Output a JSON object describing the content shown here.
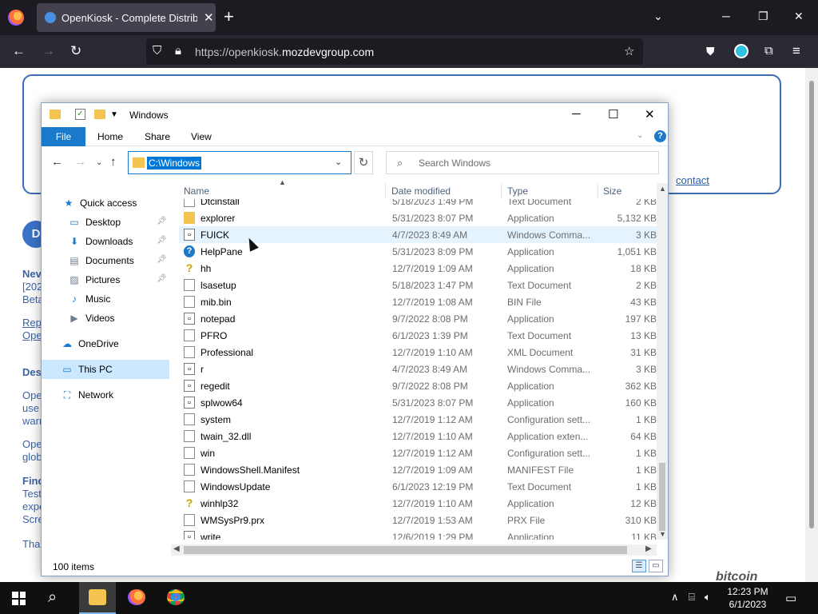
{
  "browser": {
    "tab_title": "OpenKiosk - Complete Distribu",
    "tab_close": "✕",
    "new_tab": "+",
    "url_prefix": "https://openkiosk.",
    "url_domain": "mozdevgroup.com"
  },
  "page": {
    "contact": "contact",
    "circle_letter": "D",
    "fragments": [
      "Nev",
      "[202",
      "Beta",
      "Rep",
      "Ope",
      "Des",
      "Ope",
      "use",
      "warr",
      "Ope",
      "glob",
      "Find",
      "Test",
      "expe",
      "Scre",
      "Than"
    ],
    "bitcoin": "bitcoin"
  },
  "explorer": {
    "title": "Windows",
    "ribbon": {
      "file": "File",
      "tabs": [
        "Home",
        "Share",
        "View"
      ]
    },
    "address": "C:\\Windows",
    "search_placeholder": "Search Windows",
    "status": "100 items",
    "columns": {
      "name": "Name",
      "date": "Date modified",
      "type": "Type",
      "size": "Size"
    },
    "sidebar": [
      {
        "label": "Quick access",
        "icon": "star-icon"
      },
      {
        "label": "Desktop",
        "icon": "desktop-icon",
        "pinned": true
      },
      {
        "label": "Downloads",
        "icon": "download-icon",
        "pinned": true
      },
      {
        "label": "Documents",
        "icon": "documents-icon",
        "pinned": true
      },
      {
        "label": "Pictures",
        "icon": "pictures-icon",
        "pinned": true
      },
      {
        "label": "Music",
        "icon": "music-icon"
      },
      {
        "label": "Videos",
        "icon": "videos-icon"
      },
      {
        "label": "OneDrive",
        "icon": "cloud-icon"
      },
      {
        "label": "This PC",
        "icon": "computer-icon",
        "selected": true
      },
      {
        "label": "Network",
        "icon": "network-icon"
      }
    ],
    "files": [
      {
        "name": "Dtcinstall",
        "date": "5/18/2023 1:49 PM",
        "type": "Text Document",
        "size": "2 KB",
        "icon": "doc"
      },
      {
        "name": "explorer",
        "date": "5/31/2023 8:07 PM",
        "type": "Application",
        "size": "5,132 KB",
        "icon": "folder"
      },
      {
        "name": "FUICK",
        "date": "4/7/2023 8:49 AM",
        "type": "Windows Comma...",
        "size": "3 KB",
        "icon": "app",
        "hover": true
      },
      {
        "name": "HelpPane",
        "date": "5/31/2023 8:09 PM",
        "type": "Application",
        "size": "1,051 KB",
        "icon": "help"
      },
      {
        "name": "hh",
        "date": "12/7/2019 1:09 AM",
        "type": "Application",
        "size": "18 KB",
        "icon": "hh"
      },
      {
        "name": "lsasetup",
        "date": "5/18/2023 1:47 PM",
        "type": "Text Document",
        "size": "2 KB",
        "icon": "doc"
      },
      {
        "name": "mib.bin",
        "date": "12/7/2019 1:08 AM",
        "type": "BIN File",
        "size": "43 KB",
        "icon": "doc"
      },
      {
        "name": "notepad",
        "date": "9/7/2022 8:08 PM",
        "type": "Application",
        "size": "197 KB",
        "icon": "app"
      },
      {
        "name": "PFRO",
        "date": "6/1/2023 1:39 PM",
        "type": "Text Document",
        "size": "13 KB",
        "icon": "doc"
      },
      {
        "name": "Professional",
        "date": "12/7/2019 1:10 AM",
        "type": "XML Document",
        "size": "31 KB",
        "icon": "doc"
      },
      {
        "name": "r",
        "date": "4/7/2023 8:49 AM",
        "type": "Windows Comma...",
        "size": "3 KB",
        "icon": "app"
      },
      {
        "name": "regedit",
        "date": "9/7/2022 8:08 PM",
        "type": "Application",
        "size": "362 KB",
        "icon": "app"
      },
      {
        "name": "splwow64",
        "date": "5/31/2023 8:07 PM",
        "type": "Application",
        "size": "160 KB",
        "icon": "app"
      },
      {
        "name": "system",
        "date": "12/7/2019 1:12 AM",
        "type": "Configuration sett...",
        "size": "1 KB",
        "icon": "doc"
      },
      {
        "name": "twain_32.dll",
        "date": "12/7/2019 1:10 AM",
        "type": "Application exten...",
        "size": "64 KB",
        "icon": "doc"
      },
      {
        "name": "win",
        "date": "12/7/2019 1:12 AM",
        "type": "Configuration sett...",
        "size": "1 KB",
        "icon": "doc"
      },
      {
        "name": "WindowsShell.Manifest",
        "date": "12/7/2019 1:09 AM",
        "type": "MANIFEST File",
        "size": "1 KB",
        "icon": "doc"
      },
      {
        "name": "WindowsUpdate",
        "date": "6/1/2023 12:19 PM",
        "type": "Text Document",
        "size": "1 KB",
        "icon": "doc"
      },
      {
        "name": "winhlp32",
        "date": "12/7/2019 1:10 AM",
        "type": "Application",
        "size": "12 KB",
        "icon": "hh"
      },
      {
        "name": "WMSysPr9.prx",
        "date": "12/7/2019 1:53 AM",
        "type": "PRX File",
        "size": "310 KB",
        "icon": "doc"
      },
      {
        "name": "write",
        "date": "12/6/2019 1:29 PM",
        "type": "Application",
        "size": "11 KB",
        "icon": "app"
      }
    ]
  },
  "taskbar": {
    "time": "12:23 PM",
    "date": "6/1/2023"
  }
}
